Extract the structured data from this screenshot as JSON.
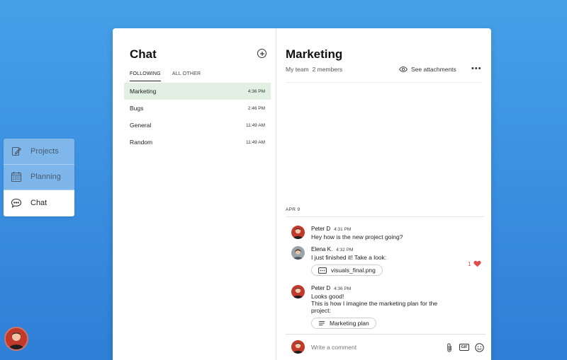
{
  "nav": {
    "items": [
      {
        "label": "Projects",
        "icon": "edit-icon",
        "active": false
      },
      {
        "label": "Planning",
        "icon": "calendar-icon",
        "active": false
      },
      {
        "label": "Chat",
        "icon": "chat-bubble-icon",
        "active": true
      }
    ]
  },
  "chat_list": {
    "title": "Chat",
    "tabs": [
      {
        "label": "FOLLOWING",
        "active": true
      },
      {
        "label": "ALL OTHER",
        "active": false
      }
    ],
    "channels": [
      {
        "name": "Marketing",
        "time": "4:36 PM",
        "selected": true
      },
      {
        "name": "Bugs",
        "time": "2:46 PM",
        "selected": false
      },
      {
        "name": "General",
        "time": "11:49 AM",
        "selected": false
      },
      {
        "name": "Random",
        "time": "11:49 AM",
        "selected": false
      }
    ]
  },
  "conversation": {
    "title": "Marketing",
    "team": "My team",
    "members": "2 members",
    "see_attachments": "See attachments",
    "more": "•••",
    "date": "APR 9",
    "messages": [
      {
        "author": "Peter D",
        "time": "4:31 PM",
        "lines": [
          "Hey how is the new project going?"
        ]
      },
      {
        "author": "Elena K.",
        "time": "4:32 PM",
        "lines": [
          "I just finished it! Take a look:"
        ],
        "attachment": "visuals_final.png",
        "reaction": {
          "count": "1",
          "icon": "heart-icon"
        }
      },
      {
        "author": "Peter D",
        "time": "4:36 PM",
        "lines": [
          "Looks good!",
          "This is how I imagine the marketing plan for the",
          "project:"
        ],
        "attachment": "Marketing plan"
      }
    ],
    "composer": {
      "placeholder": "Write a comment",
      "gif_label": "GIF"
    }
  },
  "colors": {
    "accent_bg": "#3a8ee0",
    "selected_channel": "#e2efe3",
    "heart": "#e14b4b"
  }
}
